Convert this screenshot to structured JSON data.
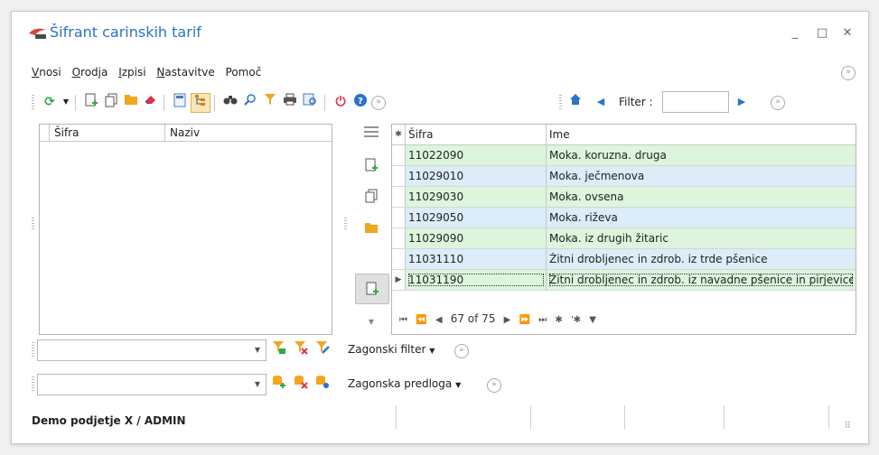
{
  "window": {
    "title": "Šifrant carinskih tarif",
    "controls": {
      "minimize": "_",
      "maximize": "□",
      "close": "✕"
    }
  },
  "menu": [
    {
      "underline": "V",
      "rest": "nosi"
    },
    {
      "underline": "O",
      "rest": "rodja"
    },
    {
      "underline": "I",
      "rest": "zpisi"
    },
    {
      "underline": "N",
      "rest": "astavitve"
    },
    {
      "underline": "",
      "rest": "Pomoč"
    }
  ],
  "filter": {
    "label": "Filter :",
    "value": ""
  },
  "left_grid": {
    "columns": [
      "Šifra",
      "Naziv"
    ]
  },
  "right_grid": {
    "columns": [
      "Šifra",
      "Ime"
    ],
    "rows": [
      {
        "sifra": "11022090",
        "ime": "Moka. koruzna. druga"
      },
      {
        "sifra": "11029010",
        "ime": "Moka. ječmenova"
      },
      {
        "sifra": "11029030",
        "ime": "Moka. ovsena"
      },
      {
        "sifra": "11029050",
        "ime": "Moka. riževa"
      },
      {
        "sifra": "11029090",
        "ime": "Moka. iz drugih žitaric"
      },
      {
        "sifra": "11031110",
        "ime": "Žitni drobljenec in zdrob. iz trde pšenice"
      },
      {
        "sifra": "11031190",
        "ime": "Žitni drobljenec in zdrob. iz navadne pšenice in pirjevice"
      }
    ],
    "navigator": {
      "position": "67 of 75"
    }
  },
  "filter_row": {
    "label": "Zagonski filter"
  },
  "template_row": {
    "label": "Zagonska predloga"
  },
  "status": {
    "text": "Demo podjetje X / ADMIN"
  },
  "colors": {
    "accent": "#2a73c9",
    "row_green": "#ddf5dd",
    "row_blue": "#dcecf8"
  }
}
